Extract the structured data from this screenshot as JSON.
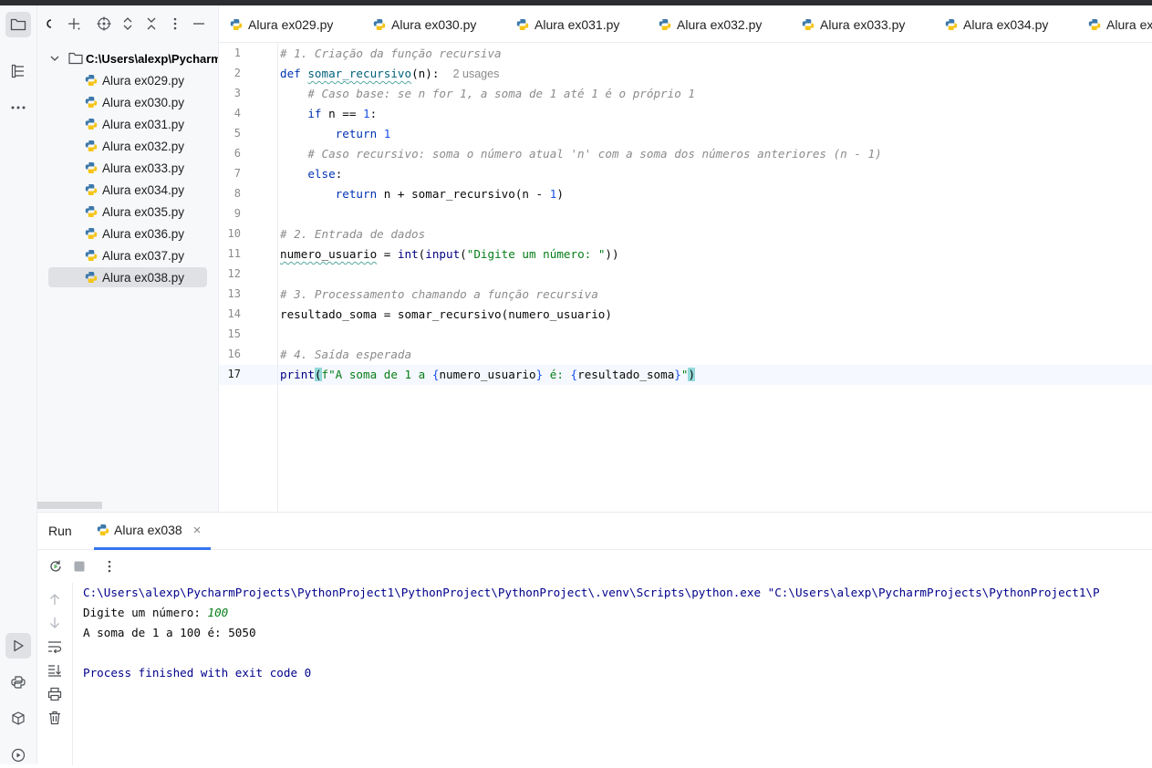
{
  "project": {
    "root_label": "C:\\Users\\alexp\\Pycharm",
    "files": [
      {
        "name": "Alura ex029.py"
      },
      {
        "name": "Alura ex030.py"
      },
      {
        "name": "Alura ex031.py"
      },
      {
        "name": "Alura ex032.py"
      },
      {
        "name": "Alura ex033.py"
      },
      {
        "name": "Alura ex034.py"
      },
      {
        "name": "Alura ex035.py"
      },
      {
        "name": "Alura ex036.py"
      },
      {
        "name": "Alura ex037.py"
      },
      {
        "name": "Alura ex038.py",
        "selected": true
      }
    ]
  },
  "tabs": [
    "Alura ex029.py",
    "Alura ex030.py",
    "Alura ex031.py",
    "Alura ex032.py",
    "Alura ex033.py",
    "Alura ex034.py",
    "Alura ex"
  ],
  "editor": {
    "line_numbers": [
      "1",
      "2",
      "3",
      "4",
      "5",
      "6",
      "7",
      "8",
      "9",
      "10",
      "11",
      "12",
      "13",
      "14",
      "15",
      "16",
      "17"
    ],
    "current_line": 17,
    "usages_hint": "2 usages",
    "tokens": {
      "l1_comment": "# 1. Criação da função recursiva",
      "l2_def": "def",
      "l2_fn": "somar_recursivo",
      "l2_rest": "(n):",
      "l3_comment": "# Caso base: se n for 1, a soma de 1 até 1 é o próprio 1",
      "l4_if": "if",
      "l4_rest": " n == ",
      "l4_num": "1",
      "l4_colon": ":",
      "l5_return": "return",
      "l5_num": "1",
      "l6_comment": "# Caso recursivo: soma o número atual 'n' com a soma dos números anteriores (n - 1)",
      "l7_else": "else",
      "l7_colon": ":",
      "l8_return": "return",
      "l8_rest": " n + somar_recursivo(n - ",
      "l8_num": "1",
      "l8_close": ")",
      "l10_comment": "# 2. Entrada de dados",
      "l11_var": "numero_usuario",
      "l11_eq": " = ",
      "l11_int": "int",
      "l11_p1": "(",
      "l11_input": "input",
      "l11_p2": "(",
      "l11_str": "\"Digite um número: \"",
      "l11_p3": "))",
      "l13_comment": "# 3. Processamento chamando a função recursiva",
      "l14_code": "resultado_soma = somar_recursivo(numero_usuario)",
      "l16_comment": "# 4. Saída esperada",
      "l17_print": "print",
      "l17_open": "(",
      "l17_fstr1": "f\"A soma de 1 a ",
      "l17_b1": "{",
      "l17_v1": "numero_usuario",
      "l17_b2": "}",
      "l17_fstr2": " é: ",
      "l17_b3": "{",
      "l17_v2": "resultado_soma",
      "l17_b4": "}",
      "l17_q": "\"",
      "l17_close": ")"
    }
  },
  "run": {
    "title": "Run",
    "tab_label": "Alura ex038",
    "console": {
      "cmd": "C:\\Users\\alexp\\PycharmProjects\\PythonProject1\\PythonProject\\PythonProject\\.venv\\Scripts\\python.exe \"C:\\Users\\alexp\\PycharmProjects\\PythonProject1\\P",
      "prompt": "Digite um número: ",
      "user_input": "100",
      "result": "A soma de 1 a 100 é: 5050",
      "finished": "Process finished with exit code 0"
    }
  },
  "colors": {
    "keyword": "#0033b3",
    "function": "#00627a",
    "number": "#1750eb",
    "string": "#067d17",
    "comment": "#8c8c8c",
    "accent": "#3574f0"
  }
}
